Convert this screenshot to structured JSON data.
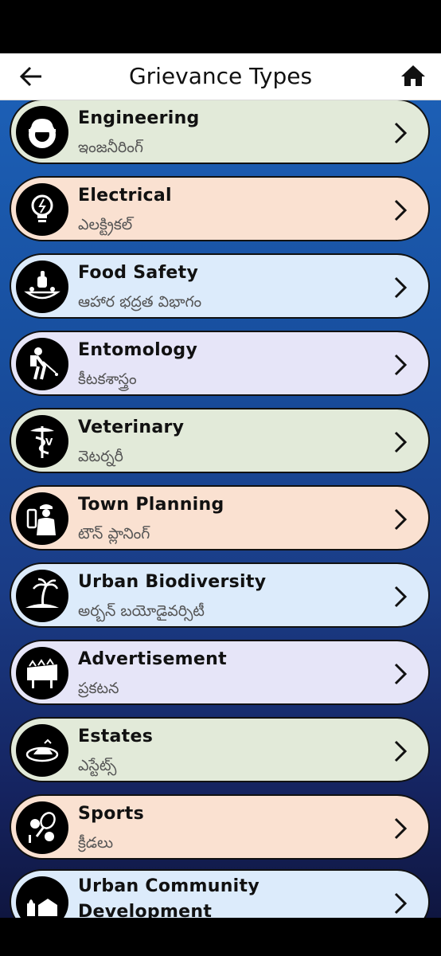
{
  "header": {
    "title": "Grievance Types"
  },
  "colors": {
    "green": "#e2ead9",
    "peach": "#fae1d1",
    "blue": "#dcebfb",
    "lavender": "#e6e5f8"
  },
  "items": [
    {
      "title": "Engineering",
      "subtitle": "ఇంజనీరింగ్",
      "icon": "engineering-helmet-gear-icon"
    },
    {
      "title": "Electrical",
      "subtitle": "ఎలక్ట్రికల్",
      "icon": "lightbulb-icon"
    },
    {
      "title": "Food Safety",
      "subtitle": "ఆహార భద్రత విభాగం",
      "icon": "food-thumbs-up-icon"
    },
    {
      "title": "Entomology",
      "subtitle": "కీటకశాస్త్రం",
      "icon": "sprayer-person-icon"
    },
    {
      "title": "Veterinary",
      "subtitle": "వెటర్నరీ",
      "icon": "caduceus-icon"
    },
    {
      "title": "Town Planning",
      "subtitle": "టౌన్ ప్లానింగ్",
      "icon": "planner-worker-icon"
    },
    {
      "title": "Urban Biodiversity",
      "subtitle": "అర్బన్ బయోడైవర్సిటీ",
      "icon": "palm-island-icon"
    },
    {
      "title": "Advertisement",
      "subtitle": "ప్రకటన",
      "icon": "billboard-icon"
    },
    {
      "title": "Estates",
      "subtitle": "ఎస్టేట్స్",
      "icon": "land-estate-icon"
    },
    {
      "title": "Sports",
      "subtitle": "క్రీడలు",
      "icon": "sports-balls-icon"
    },
    {
      "title": "Urban Community Development",
      "subtitle": "",
      "icon": "community-buildings-icon"
    }
  ]
}
